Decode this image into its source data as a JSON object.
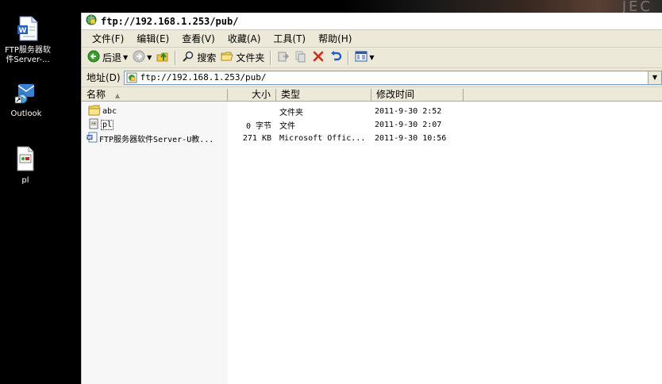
{
  "desktop": {
    "icons": [
      {
        "label": "FTP服务器软\n件Server-..."
      },
      {
        "label": "Outlook"
      },
      {
        "label": "pl"
      }
    ],
    "wallpaper_text": "JEC"
  },
  "window": {
    "title": "ftp://192.168.1.253/pub/",
    "menu": [
      "文件(F)",
      "编辑(E)",
      "查看(V)",
      "收藏(A)",
      "工具(T)",
      "帮助(H)"
    ],
    "toolbar": {
      "back_label": "后退",
      "search_label": "搜索",
      "folders_label": "文件夹"
    },
    "address": {
      "label": "地址(D)",
      "value": "ftp://192.168.1.253/pub/"
    },
    "columns": {
      "name": "名称",
      "size": "大小",
      "type": "类型",
      "modified": "修改时间"
    },
    "files": [
      {
        "name": "abc",
        "size": "",
        "type": "文件夹",
        "modified": "2011-9-30 2:52",
        "icon": "folder-icon"
      },
      {
        "name": "pl",
        "size": "0 字节",
        "type": "文件",
        "modified": "2011-9-30 2:07",
        "icon": "file-icon"
      },
      {
        "name": "FTP服务器软件Server-U教...",
        "size": "271 KB",
        "type": "Microsoft Offic...",
        "modified": "2011-9-30 10:56",
        "icon": "word-doc-icon"
      }
    ]
  },
  "colors": {
    "window_chrome": "#ece9d8",
    "desktop": "#000000",
    "address_border": "#7f9db9",
    "back_green": "#3a9b2e",
    "delete_red": "#d42a1a",
    "undo_blue": "#1f5fbf"
  }
}
